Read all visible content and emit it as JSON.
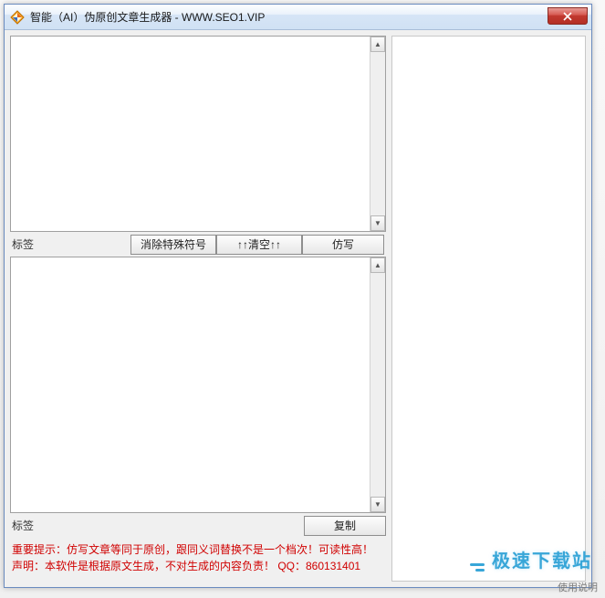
{
  "window": {
    "title": "智能（AI）伪原创文章生成器 - WWW.SEO1.VIP"
  },
  "top": {
    "label": "标签",
    "textarea_value": "",
    "buttons": {
      "clear_special": "消除特殊符号",
      "empty": "↑↑清空↑↑",
      "rewrite": "仿写"
    }
  },
  "bottom": {
    "label": "标签",
    "textarea_value": "",
    "buttons": {
      "copy": "复制"
    }
  },
  "footer": {
    "line1": "重要提示：仿写文章等同于原创，跟同义词替换不是一个档次！可读性高！",
    "line2": "声明：本软件是根据原文生成，不对生成的内容负责！   QQ：860131401"
  },
  "right_panel": {
    "content": ""
  },
  "watermark": {
    "logo_text": "极速下载站",
    "usage_note": "使用说明"
  }
}
